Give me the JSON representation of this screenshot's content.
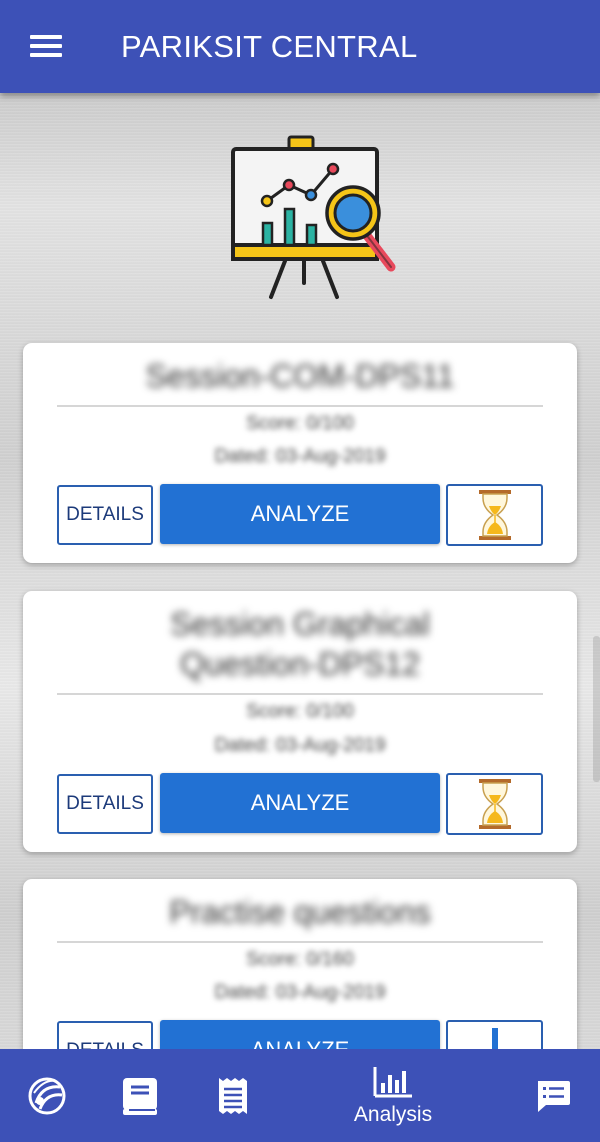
{
  "header": {
    "title": "PARIKSIT CENTRAL",
    "menu_icon": "hamburger-menu-icon"
  },
  "hero": {
    "icon": "presentation-analytics-icon"
  },
  "sessions": [
    {
      "title": "Session-COM-DPS11",
      "score": "Score: 0/100",
      "date": "Dated: 03-Aug-2019",
      "details_label": "DETAILS",
      "analyze_label": "ANALYZE",
      "action_icon": "hourglass-icon"
    },
    {
      "title_line1": "Session Graphical",
      "title_line2": "Question-DPS12",
      "score": "Score: 0/100",
      "date": "Dated: 03-Aug-2019",
      "details_label": "DETAILS",
      "analyze_label": "ANALYZE",
      "action_icon": "hourglass-icon"
    },
    {
      "title": "Practise questions",
      "score": "Score: 0/160",
      "date": "Dated: 03-Aug-2019",
      "details_label": "DETAILS",
      "analyze_label": "ANALYZE",
      "action_icon": "download-icon"
    }
  ],
  "bottom_nav": {
    "items": [
      {
        "icon": "logo-icon",
        "label": ""
      },
      {
        "icon": "book-icon",
        "label": ""
      },
      {
        "icon": "receipt-icon",
        "label": ""
      },
      {
        "icon": "bar-chart-icon",
        "label": "Analysis"
      },
      {
        "icon": "chat-list-icon",
        "label": ""
      }
    ]
  },
  "colors": {
    "primary": "#3d51b7",
    "accent_button": "#2271d3",
    "outline_button": "#2a5fb0",
    "hero_yellow": "#f5c518",
    "hero_teal": "#2bb3a3",
    "hero_red": "#e8495c",
    "hero_blue": "#3a8fdc"
  }
}
